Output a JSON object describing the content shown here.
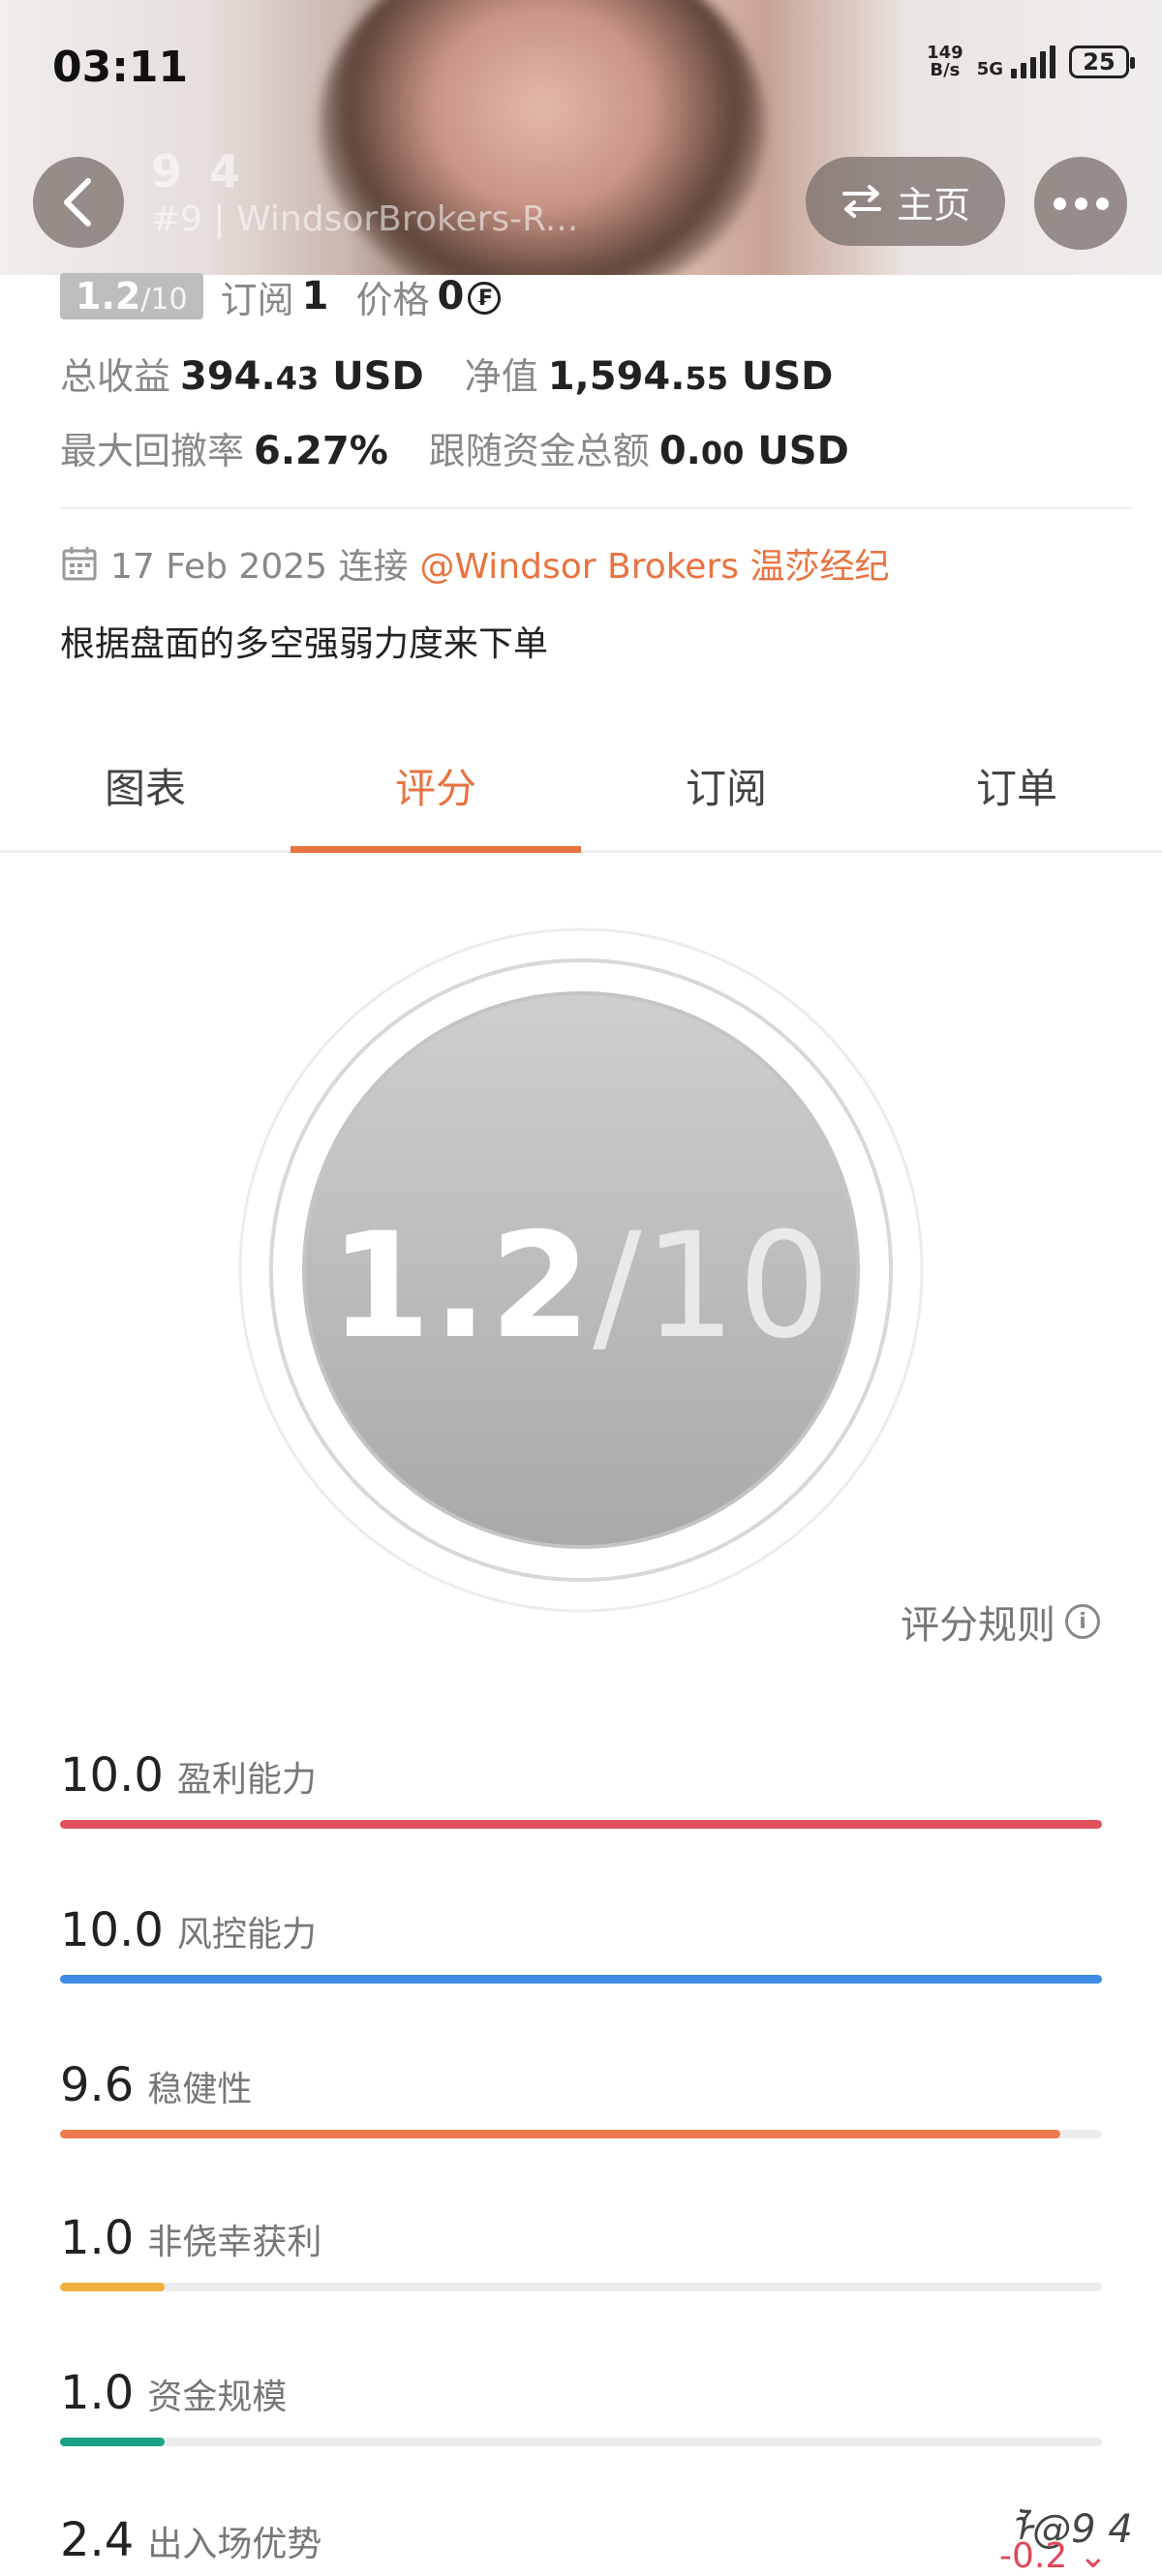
{
  "status_bar": {
    "time": "03:11",
    "net_speed_top": "149",
    "net_speed_bottom": "B/s",
    "network": "5G",
    "battery": "25"
  },
  "header": {
    "title": "9 4",
    "subtitle": "#9 | WindsorBrokers-R...",
    "home_label": "主页"
  },
  "info": {
    "score_num": "1.2",
    "score_den": "/10",
    "subscribe_label": "订阅",
    "subscribe_value": "1",
    "price_label": "价格",
    "price_value": "0",
    "price_icon": "₣",
    "total_profit_label": "总收益",
    "total_profit_int": "394.",
    "total_profit_dec": "43",
    "total_profit_unit": "USD",
    "net_value_label": "净值",
    "net_value_int": "1,594.",
    "net_value_dec": "55",
    "net_value_unit": "USD",
    "max_drawdown_label": "最大回撤率",
    "max_drawdown_value": "6.27%",
    "follow_funds_label": "跟随资金总额",
    "follow_funds_int": "0.",
    "follow_funds_dec": "00",
    "follow_funds_unit": "USD",
    "connect_date": "17 Feb 2025 连接",
    "broker_link": "@Windsor Brokers 温莎经纪",
    "description": "根据盘面的多空强弱力度来下单"
  },
  "tabs": [
    "图表",
    "评分",
    "订阅",
    "订单"
  ],
  "active_tab": 1,
  "big_score": {
    "num": "1.2",
    "den": "/10"
  },
  "rules_label": "评分规则",
  "metrics": [
    {
      "value": "10.0",
      "label": "盈利能力",
      "fraction": 1.0,
      "color": "#e0515d"
    },
    {
      "value": "10.0",
      "label": "风控能力",
      "fraction": 1.0,
      "color": "#3e8ae6"
    },
    {
      "value": "9.6",
      "label": "稳健性",
      "fraction": 0.96,
      "color": "#ec7a4c"
    },
    {
      "value": "1.0",
      "label": "非侥幸获利",
      "fraction": 0.1,
      "color": "#f2b03d"
    },
    {
      "value": "1.0",
      "label": "资金规模",
      "fraction": 0.1,
      "color": "#1aa187"
    },
    {
      "value": "2.4",
      "label": "出入场优势",
      "fraction": 0.24,
      "color": "#888888"
    }
  ],
  "delta": "-0.2",
  "watermark": "ᠯ@9 4"
}
